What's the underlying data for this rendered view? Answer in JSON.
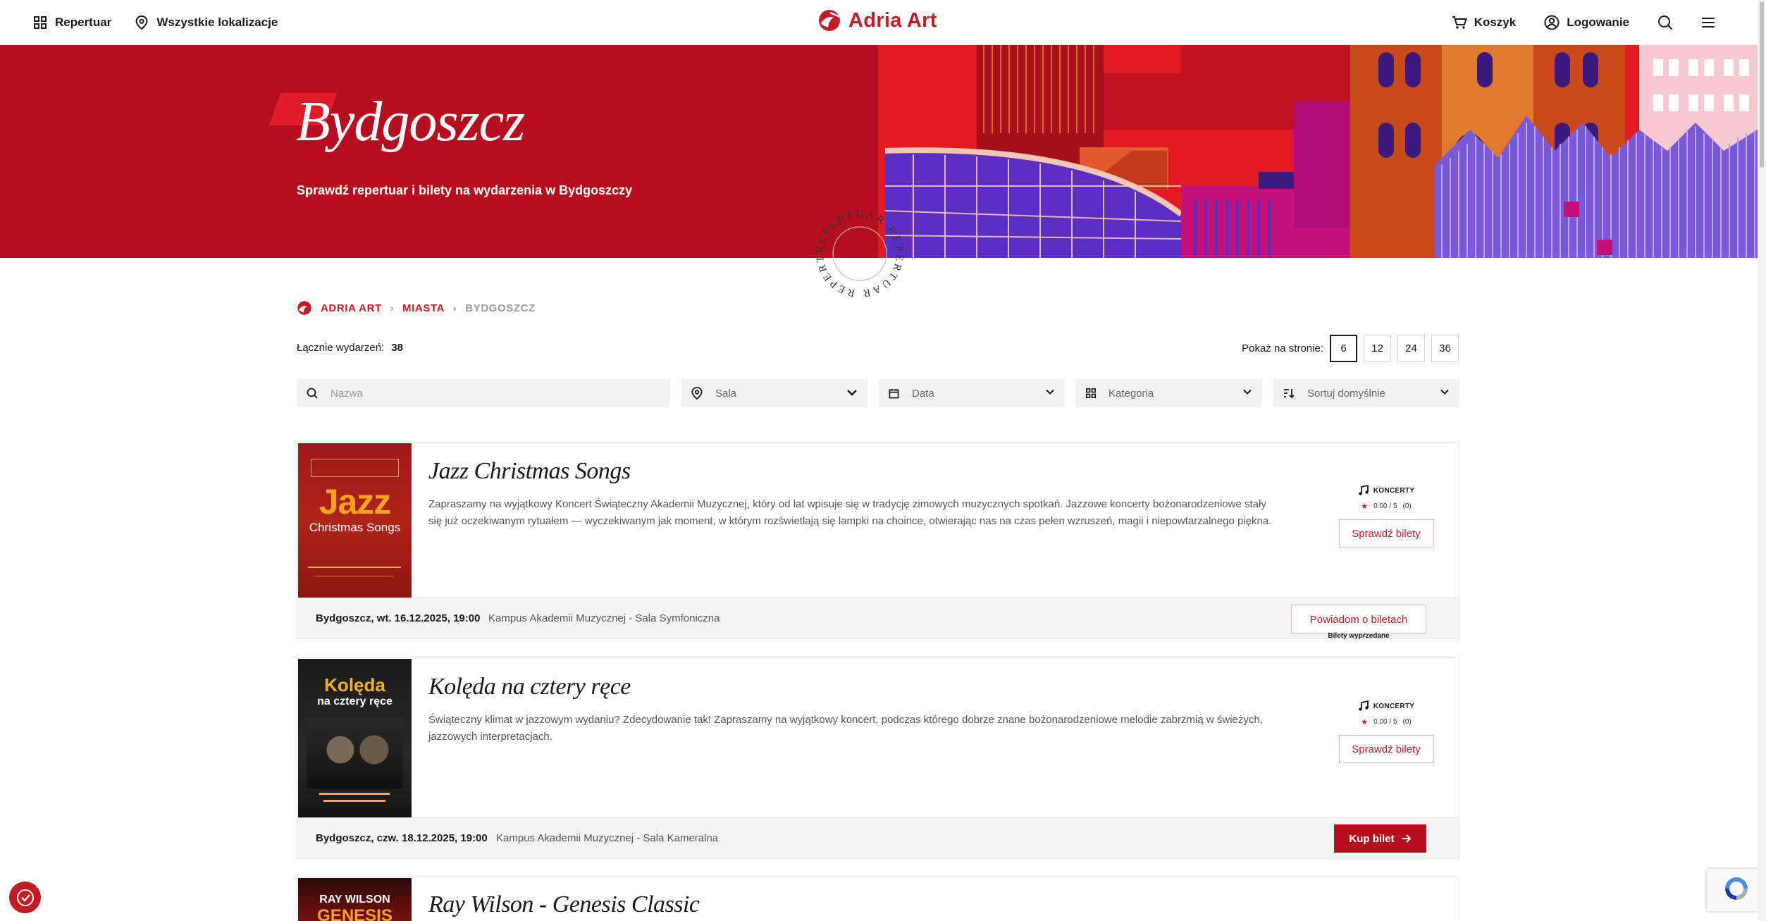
{
  "header": {
    "repertuar": "Repertuar",
    "lokalizacje": "Wszystkie lokalizacje",
    "logo": "Adria Art",
    "koszyk": "Koszyk",
    "logowanie": "Logowanie"
  },
  "hero": {
    "title": "Bydgoszcz",
    "subtitle": "Sprawdź repertuar i bilety na wydarzenia w Bydgoszczy",
    "stamp_text": "REPERTUAR REPERTUAR REPERTUAR"
  },
  "breadcrumb": {
    "home": "ADRIA ART",
    "cities": "MIASTA",
    "current": "BYDGOSZCZ"
  },
  "listing": {
    "total_label": "Łącznie wydarzeń:",
    "total_value": "38",
    "page_size_label": "Pokaż na stronie:",
    "page_sizes": [
      "6",
      "12",
      "24",
      "36"
    ],
    "page_size_selected": "6"
  },
  "filters": {
    "name_placeholder": "Nazwa",
    "sala": "Sala",
    "data": "Data",
    "kategoria": "Kategoria",
    "sort": "Sortuj domyślnie"
  },
  "events": [
    {
      "title": "Jazz Christmas Songs",
      "description": "Zapraszamy na wyjątkowy Koncert Świąteczny Akademii Muzycznej, który od lat wpisuje się w tradycję zimowych muzycznych spotkań. Jazzowe koncerty bożonarodzeniowe stały się już oczekiwanym rytuałem — wyczekiwanym jak moment, w którym rozświetlają się lampki na choince, otwierając nas na czas pełen wzruszeń, magii i niepowtarzalnego piękna.",
      "category": "KONCERTY",
      "rating": "0.00 / 5",
      "rating_count": "(0)",
      "check_label": "Sprawdź bilety",
      "date": "Bydgoszcz, wt. 16.12.2025, 19:00",
      "venue": "Kampus Akademii Muzycznej - Sala Symfoniczna",
      "action_label": "Powiadom o biletach",
      "sold_out": "Bilety wyprzedane",
      "poster_big": "Jazz",
      "poster_small": "Christmas Songs"
    },
    {
      "title": "Kolęda na cztery ręce",
      "description": "Świąteczny klimat w jazzowym wydaniu? Zdecydowanie tak! Zapraszamy na wyjątkowy koncert, podczas którego dobrze znane bożonarodzeniowe melodie zabrzmią w świeżych, jazzowych interpretacjach.",
      "category": "KONCERTY",
      "rating": "0.00 / 5",
      "rating_count": "(0)",
      "check_label": "Sprawdź bilety",
      "date": "Bydgoszcz, czw. 18.12.2025, 19:00",
      "venue": "Kampus Akademii Muzycznej - Sala Kameralna",
      "action_label": "Kup bilet",
      "poster_big": "Kolęda",
      "poster_small": "na cztery ręce"
    },
    {
      "title": "Ray Wilson - Genesis Classic",
      "poster_big": "RAY WILSON",
      "poster_small": "GENESIS"
    }
  ],
  "colors": {
    "brand_red": "#c01d27",
    "hero_red": "#b50f1f",
    "purple": "#5a2fc2",
    "magenta": "#c4127a"
  }
}
